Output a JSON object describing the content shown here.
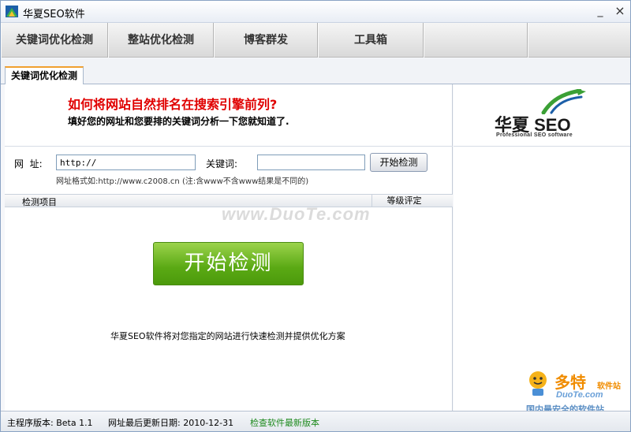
{
  "window": {
    "title": "华夏SEO软件"
  },
  "toolbar": {
    "items": [
      "关键词优化检测",
      "整站优化检测",
      "博客群发",
      "工具箱"
    ]
  },
  "tabs": {
    "active": "关键词优化检测"
  },
  "intro": {
    "headline": "如何将网站自然排名在搜索引擎前列?",
    "subline": "填好您的网址和您要排的关键词分析一下您就知道了."
  },
  "form": {
    "url_label": "网  址:",
    "url_value": "http://",
    "keyword_label": "关键词:",
    "keyword_value": "",
    "check_button": "开始检测",
    "hint": "网址格式如:http://www.c2008.cn  (注:含www不含www结果是不同的)"
  },
  "grid": {
    "col_item": "检测项目",
    "col_grade": "等级评定"
  },
  "main": {
    "start_button": "开始检测",
    "description": "华夏SEO软件将对您指定的网站进行快速检测并提供优化方案"
  },
  "logo": {
    "text": "华夏 SEO",
    "tagline": "Professional SEO software"
  },
  "status": {
    "version": "主程序版本: Beta 1.1",
    "update_date": "网址最后更新日期: 2010-12-31",
    "check_update": "检查软件最新版本"
  },
  "watermark": {
    "center": "www.DuoTe.com",
    "brand": "多特",
    "brand_suffix": "软件站",
    "site": "DuoTe.com",
    "slogan": "国内最安全的软件站"
  },
  "colors": {
    "accent_red": "#e00000",
    "start_green": "#5aa914",
    "link_green": "#1e8a1e"
  }
}
